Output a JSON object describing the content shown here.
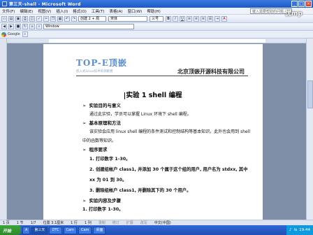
{
  "window": {
    "title": "第三天-shell - Microsoft Word"
  },
  "menu": {
    "items": [
      "文件(F)",
      "编辑(E)",
      "视图(V)",
      "插入(I)",
      "格式(O)",
      "工具(T)",
      "表格(A)",
      "窗口(W)",
      "帮助(H)"
    ],
    "help_placeholder": "键入需要帮助的问题"
  },
  "toolbar": {
    "style_value": "创建 2 + 局",
    "font_value": "宋体",
    "size_value": "三号",
    "bold": "B",
    "italic": "I",
    "underline": "U"
  },
  "toolbar2": {
    "window_value": "Window"
  },
  "toolbar3": {
    "google": "Google"
  },
  "overlay_text": "优mp",
  "document": {
    "logo_big": "TOP-E顶嵌",
    "logo_small": "嵌入式Linux技术的领跑者",
    "company": "北京顶嵌开源科技有限公司",
    "title": "实验 1   shell 编程",
    "lines": [
      {
        "bullet": "➢",
        "text": "实验目的与意义",
        "style": "h"
      },
      {
        "bullet": "",
        "text": "通过此实验，学员可以掌握 Linux 环境下 shell 编程。",
        "style": ""
      },
      {
        "bullet": "➢",
        "text": "基本原理和方法",
        "style": "h"
      },
      {
        "bullet": "",
        "text": "该实验会应用 linux shell 编程的条件测试和控制结构等基本知识，此外也会用到 shell",
        "style": ""
      },
      {
        "bullet": "",
        "text": "中的函数等知识。",
        "style": ""
      },
      {
        "bullet": "➢",
        "text": "程序要求",
        "style": "h"
      },
      {
        "bullet": "",
        "text": "1. 打印数字 1-30。",
        "style": "b"
      },
      {
        "bullet": "",
        "text": "2. 创建组帐户 class1, 并添加 30 个属于这个组的用户, 用户名为 stdxx, 其中",
        "style": "b"
      },
      {
        "bullet": "",
        "text": "xx 为 01 到 30。",
        "style": "b"
      },
      {
        "bullet": "",
        "text": "3. 删除组帐户 class1, 并删除其下的 30 个用户。",
        "style": "b"
      },
      {
        "bullet": "➢",
        "text": "实验内容及步骤",
        "style": "h"
      },
      {
        "bullet": "",
        "text": "1. 打印数字 1-30。",
        "style": "b"
      }
    ]
  },
  "status": {
    "page": "1 页",
    "section": "1 节",
    "pages": "1/7",
    "position": "位置 3.1厘米",
    "line": "1 行",
    "col": "1 列",
    "rec": "录制",
    "trk": "修订",
    "ext": "扩展",
    "ovr": "改写",
    "lang": "中文(中国)"
  },
  "taskbar": {
    "start": "开始",
    "buttons": [
      "A",
      "第三天",
      "DTC",
      "Cam",
      "Cam",
      "桌面"
    ],
    "clock": "19:44"
  }
}
